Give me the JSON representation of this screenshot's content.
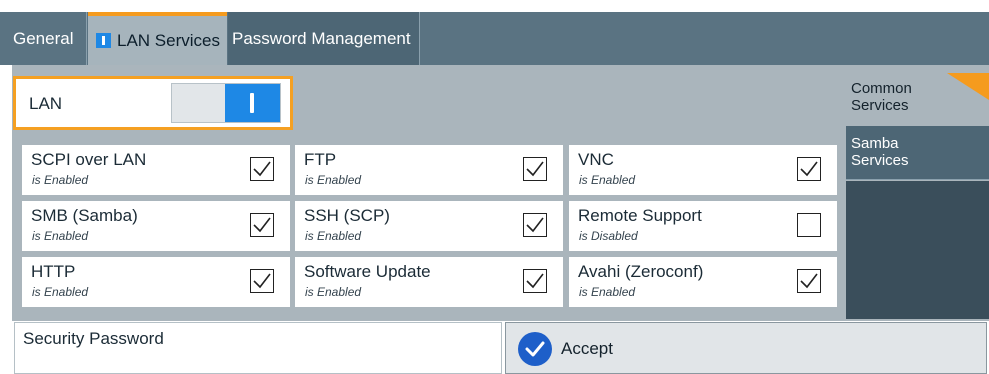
{
  "tabs": [
    {
      "label": "General"
    },
    {
      "label": "LAN Services"
    },
    {
      "label": "Password Management"
    }
  ],
  "lan": {
    "label": "LAN",
    "state": "on"
  },
  "services": [
    {
      "title": "SCPI over LAN",
      "status": "is Enabled",
      "checked": true
    },
    {
      "title": "FTP",
      "status": "is Enabled",
      "checked": true
    },
    {
      "title": "VNC",
      "status": "is Enabled",
      "checked": true
    },
    {
      "title": "SMB (Samba)",
      "status": "is Enabled",
      "checked": true
    },
    {
      "title": "SSH (SCP)",
      "status": "is Enabled",
      "checked": true
    },
    {
      "title": "Remote Support",
      "status": "is Disabled",
      "checked": false
    },
    {
      "title": "HTTP",
      "status": "is Enabled",
      "checked": true
    },
    {
      "title": "Software Update",
      "status": "is Enabled",
      "checked": true
    },
    {
      "title": "Avahi (Zeroconf)",
      "status": "is Enabled",
      "checked": true
    }
  ],
  "side_nav": {
    "common": {
      "line1": "Common",
      "line2": "Services"
    },
    "samba": {
      "line1": "Samba",
      "line2": "Services"
    }
  },
  "security_password": {
    "label": "Security Password",
    "value": ""
  },
  "accept": {
    "label": "Accept",
    "icon": "check-circle-icon"
  },
  "colors": {
    "accent": "#1e88e5",
    "highlight": "#f59b1e",
    "header": "#5a7382"
  }
}
